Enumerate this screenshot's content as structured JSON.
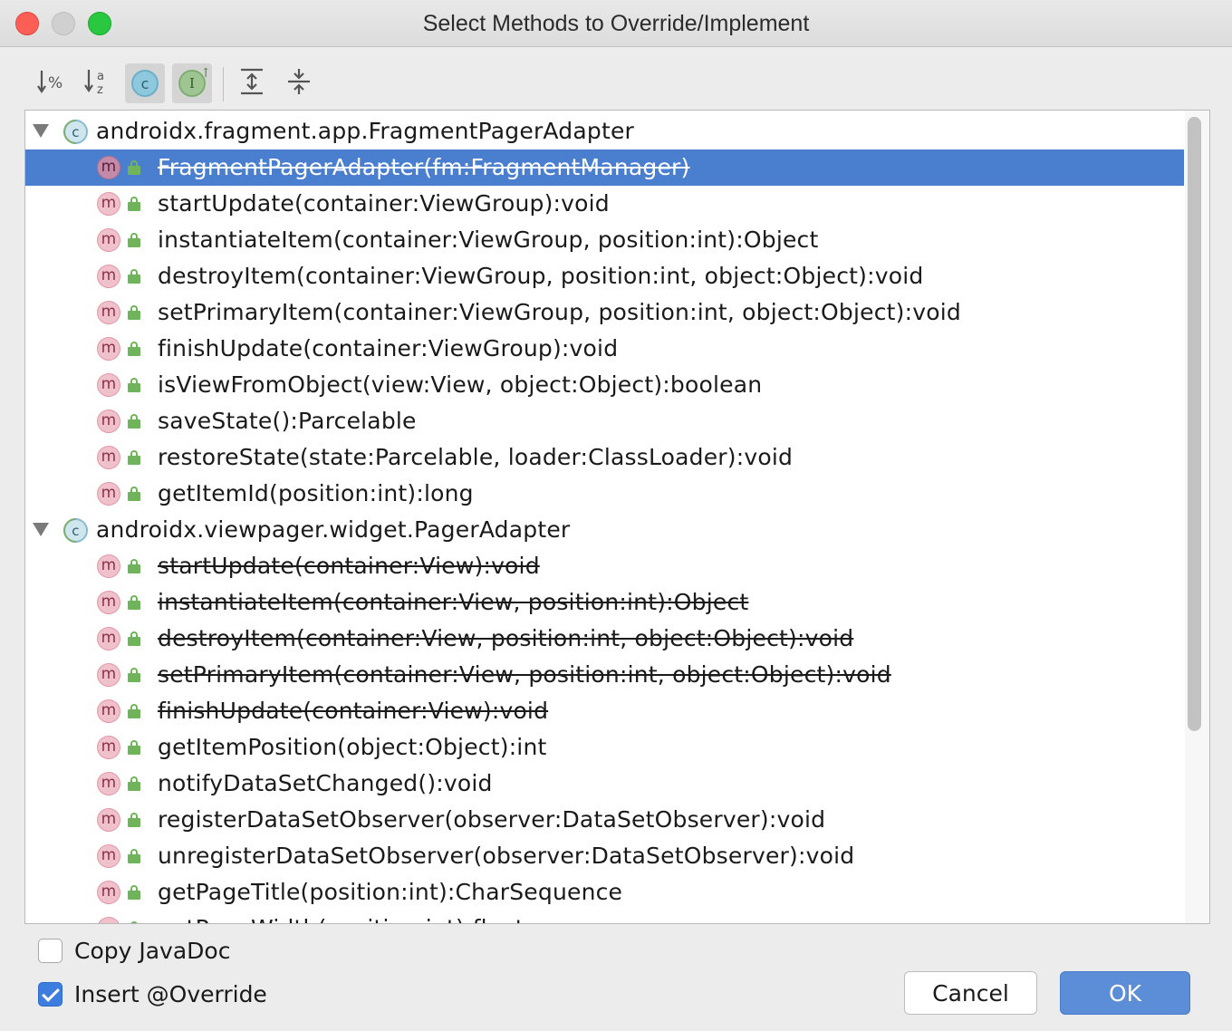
{
  "window": {
    "title": "Select Methods to Override/Implement"
  },
  "toolbar": {
    "buttons": [
      {
        "icon": "sort-by-percent-icon",
        "glyph": "↓%"
      },
      {
        "icon": "sort-alphabetically-icon",
        "glyph": "↓az"
      },
      {
        "icon": "show-classes-icon",
        "glyph": "c",
        "active": true
      },
      {
        "icon": "show-interfaces-icon",
        "glyph": "I",
        "active": true
      },
      {
        "icon": "expand-all-icon"
      },
      {
        "icon": "collapse-all-icon"
      }
    ]
  },
  "tree": {
    "groups": [
      {
        "label": "androidx.fragment.app.FragmentPagerAdapter",
        "methods": [
          {
            "label": "FragmentPagerAdapter(fm:FragmentManager)",
            "deprecated": true,
            "selected": true
          },
          {
            "label": "startUpdate(container:ViewGroup):void"
          },
          {
            "label": "instantiateItem(container:ViewGroup, position:int):Object"
          },
          {
            "label": "destroyItem(container:ViewGroup, position:int, object:Object):void"
          },
          {
            "label": "setPrimaryItem(container:ViewGroup, position:int, object:Object):void"
          },
          {
            "label": "finishUpdate(container:ViewGroup):void"
          },
          {
            "label": "isViewFromObject(view:View, object:Object):boolean"
          },
          {
            "label": "saveState():Parcelable"
          },
          {
            "label": "restoreState(state:Parcelable, loader:ClassLoader):void"
          },
          {
            "label": "getItemId(position:int):long"
          }
        ]
      },
      {
        "label": "androidx.viewpager.widget.PagerAdapter",
        "methods": [
          {
            "label": "startUpdate(container:View):void",
            "deprecated": true
          },
          {
            "label": "instantiateItem(container:View, position:int):Object",
            "deprecated": true
          },
          {
            "label": "destroyItem(container:View, position:int, object:Object):void",
            "deprecated": true
          },
          {
            "label": "setPrimaryItem(container:View, position:int, object:Object):void",
            "deprecated": true
          },
          {
            "label": "finishUpdate(container:View):void",
            "deprecated": true
          },
          {
            "label": "getItemPosition(object:Object):int"
          },
          {
            "label": "notifyDataSetChanged():void"
          },
          {
            "label": "registerDataSetObserver(observer:DataSetObserver):void"
          },
          {
            "label": "unregisterDataSetObserver(observer:DataSetObserver):void"
          },
          {
            "label": "getPageTitle(position:int):CharSequence"
          },
          {
            "label": "getPageWidth(position:int):float"
          }
        ]
      }
    ],
    "method_icon_letter": "m",
    "class_icon_letter": "c"
  },
  "options": {
    "copy_javadoc": {
      "label": "Copy JavaDoc",
      "checked": false
    },
    "insert_override": {
      "label": "Insert @Override",
      "checked": true
    }
  },
  "buttons": {
    "cancel": "Cancel",
    "ok": "OK"
  },
  "colors": {
    "selection": "#4a7ecf",
    "ok_button": "#5c8ed8",
    "checkbox_checked": "#3d7de0"
  }
}
